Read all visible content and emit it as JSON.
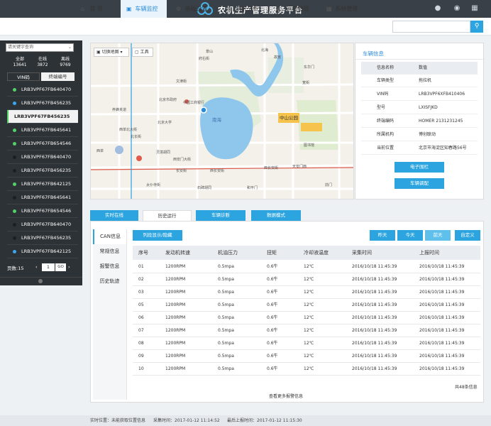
{
  "header": {
    "title": "农机生产管理服务平台",
    "icons": [
      "user-icon",
      "message-icon",
      "grid-icon"
    ]
  },
  "nav": {
    "items": [
      {
        "label": "首 页",
        "icon": "home-icon"
      },
      {
        "label": "车辆监控",
        "icon": "monitor-icon"
      },
      {
        "label": "基础设置",
        "icon": "gear-icon"
      },
      {
        "label": "统计分析",
        "icon": "chart-icon"
      },
      {
        "label": "运营管理",
        "icon": "globe-icon"
      },
      {
        "label": "系统管理",
        "icon": "settings-icon"
      }
    ],
    "search_icon": "search-icon"
  },
  "sidebar": {
    "dropdown": "请关键字查询",
    "stats": [
      {
        "label": "全部",
        "value": "13641"
      },
      {
        "label": "在线",
        "value": "3872"
      },
      {
        "label": "离线",
        "value": "9769"
      }
    ],
    "tabs": [
      "VIN码",
      "终端编号"
    ],
    "vehicles": [
      {
        "vin": "LRB3VPF67FB640470",
        "status": "green"
      },
      {
        "vin": "LRB3VPF67FB456235",
        "status": "blue"
      },
      {
        "vin": "LRB3VPF67FB456235",
        "status": "selected"
      },
      {
        "vin": "LRB3VPF67FB645641",
        "status": "green"
      },
      {
        "vin": "LRB3VPF67FB654546",
        "status": "green"
      },
      {
        "vin": "LRB3VPF67FB640470",
        "status": "gray"
      },
      {
        "vin": "LRB3VPF67FB456235",
        "status": "gray"
      },
      {
        "vin": "LRB3VPF67FB642125",
        "status": "green"
      },
      {
        "vin": "LRB3VPF67FB645641",
        "status": "gray"
      },
      {
        "vin": "LRB3VPF67FB654546",
        "status": "green"
      },
      {
        "vin": "LRB3VPF67FB640470",
        "status": "gray"
      },
      {
        "vin": "LRB3VPF67FB456235",
        "status": "gray"
      },
      {
        "vin": "LRB3VPF67FB642125",
        "status": "blue"
      }
    ],
    "pager": {
      "label": "页数:15",
      "page": "1",
      "go": "GO"
    }
  },
  "map": {
    "switch_label": "切换地图",
    "tools_label": "工具",
    "labels": [
      "景山",
      "府右街",
      "北海",
      "南海",
      "中山公园",
      "西单",
      "西长安街",
      "天安门西",
      "西长安街",
      "中国工商银行",
      "北京市政府",
      "文津街",
      "北京大学",
      "北长街",
      "东华门",
      "故宫",
      "长安街",
      "西单北大街",
      "灵境胡同",
      "宽街",
      "石碑胡同",
      "图书馆",
      "太仆寺街",
      "西安门大街",
      "养蜂夹道",
      "和平门",
      "前门"
    ]
  },
  "info": {
    "title": "车辆信息",
    "head": {
      "k": "信息名称",
      "v": "数值"
    },
    "rows": [
      {
        "k": "车辆类型",
        "v": "拖拉机"
      },
      {
        "k": "VIN码",
        "v": "LRB3VPF6XFB410406"
      },
      {
        "k": "型号",
        "v": "LXISFJKD"
      },
      {
        "k": "终端编码",
        "v": "HOMER 2131231245"
      },
      {
        "k": "所属机构",
        "v": "博创联动"
      },
      {
        "k": "当前位置",
        "v": "北京市海淀区知春路56号"
      }
    ],
    "btn1": "电子围栏",
    "btn2": "车辆调配"
  },
  "tabs": [
    "实时在线",
    "历史运行",
    "车辆诊断",
    "数据模式"
  ],
  "panel": {
    "vtabs": [
      "CAN信息",
      "常规信息",
      "报警信息",
      "历史轨迹"
    ],
    "toggle": "列段显示/隐藏",
    "dates": [
      "昨天",
      "今天",
      "前天",
      "自定义"
    ],
    "columns": [
      "序号",
      "发动机转速",
      "机油压力",
      "扭矩",
      "冷却液温度",
      "采集时间",
      "上报时间"
    ],
    "rows": [
      [
        "01",
        "1200RPM",
        "0.5mpa",
        "0.6牛",
        "12℃",
        "2016/10/18 11:45:39",
        "2016/10/18 11:45:39"
      ],
      [
        "02",
        "1200RPM",
        "0.5mpa",
        "0.6牛",
        "12℃",
        "2016/10/18 11:45:39",
        "2016/10/18 11:45:39"
      ],
      [
        "03",
        "1200RPM",
        "0.5mpa",
        "0.6牛",
        "12℃",
        "2016/10/18 11:45:39",
        "2016/10/18 11:45:39"
      ],
      [
        "05",
        "1200RPM",
        "0.5mpa",
        "0.6牛",
        "12℃",
        "2016/10/18 11:45:39",
        "2016/10/18 11:45:39"
      ],
      [
        "06",
        "1200RPM",
        "0.5mpa",
        "0.6牛",
        "12℃",
        "2016/10/18 11:45:39",
        "2016/10/18 11:45:39"
      ],
      [
        "07",
        "1200RPM",
        "0.5mpa",
        "0.6牛",
        "12℃",
        "2016/10/18 11:45:39",
        "2016/10/18 11:45:39"
      ],
      [
        "08",
        "1200RPM",
        "0.5mpa",
        "0.6牛",
        "12℃",
        "2016/10/18 11:45:39",
        "2016/10/18 11:45:39"
      ],
      [
        "09",
        "1200RPM",
        "0.5mpa",
        "0.6牛",
        "12℃",
        "2016/10/18 11:45:39",
        "2016/10/18 11:45:39"
      ],
      [
        "10",
        "1200RPM",
        "0.5mpa",
        "0.6牛",
        "12℃",
        "2016/10/18 11:45:39",
        "2016/10/18 11:45:39"
      ]
    ],
    "total": "共48条信息",
    "more": "查看更多报警信息"
  },
  "footer": {
    "pos": "实时位置：未能获取位置信息",
    "collect": "采集时间：2017-01-12 11:14:52",
    "report": "最后上报时间：2017-01-12 11:15:30"
  },
  "colors": {
    "accent": "#2ba4df",
    "header": "#3a4047",
    "sidebar": "#2d3236"
  }
}
